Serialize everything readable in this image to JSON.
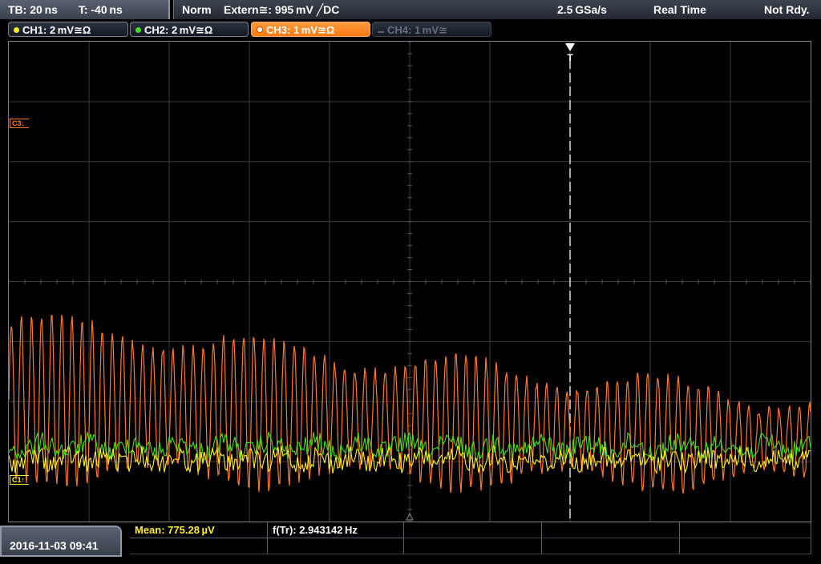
{
  "topbar": {
    "timebase": "TB: 20 ns",
    "trigger_time": "T: -40 ns",
    "mode": "Norm",
    "trigger_source": "Extern≅: 995 mV ╱DC",
    "sample_rate": "2.5 GSa/s",
    "acq_mode": "Real Time",
    "status": "Not Rdy."
  },
  "channels": [
    {
      "label": "CH1: 2 mV≅Ω",
      "color": "#ffee30",
      "state": "on"
    },
    {
      "label": "CH2: 2 mV≅Ω",
      "color": "#40e020",
      "state": "on"
    },
    {
      "label": "CH3: 1 mV≅Ω",
      "color": "#ff7a2a",
      "state": "active"
    },
    {
      "label": "CH4: 1 mV≅",
      "color": "#5a6070",
      "state": "off"
    }
  ],
  "markers": {
    "c3": "C3↓",
    "c1": "C1↑"
  },
  "bottom": {
    "datetime": "2016-11-03  09:41",
    "mean_label": "Mean: 775.28 µV",
    "freq_label": "f(Tr): 2.943142 Hz"
  },
  "colors": {
    "ch1": "#ffee30",
    "ch2": "#40e020",
    "ch3": "#ff7a2a",
    "grid": "#3c3c3c"
  }
}
